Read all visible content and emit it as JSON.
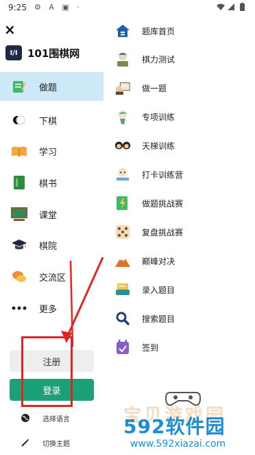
{
  "status_bar": {
    "time": "9:25",
    "icons": "⚙ A ▣ ·"
  },
  "drawer": {
    "close_label": "×",
    "brand_logo_text": "I/I",
    "brand_name": "101围棋网",
    "nav_items": [
      {
        "label": "做题",
        "icon": "pencil-notebook-icon",
        "active": true
      },
      {
        "label": "下棋",
        "icon": "go-stones-icon"
      },
      {
        "label": "学习",
        "icon": "open-book-icon"
      },
      {
        "label": "棋书",
        "icon": "green-book-icon"
      },
      {
        "label": "课堂",
        "icon": "classroom-board-icon"
      },
      {
        "label": "棋院",
        "icon": "graduation-cap-icon"
      },
      {
        "label": "交流区",
        "icon": "chat-bubbles-icon"
      },
      {
        "label": "更多",
        "icon": "more-dots-icon"
      }
    ],
    "register_label": "注册",
    "login_label": "登录",
    "bottom_links": [
      {
        "label": "选择语言",
        "icon": "globe-icon"
      },
      {
        "label": "切换主题",
        "icon": "magic-wand-icon"
      }
    ]
  },
  "menu": {
    "items": [
      {
        "label": "题库首页",
        "icon": "home-icon"
      },
      {
        "label": "棋力测试",
        "icon": "test-character-icon"
      },
      {
        "label": "做一题",
        "icon": "single-problem-icon"
      },
      {
        "label": "专项训练",
        "icon": "special-training-icon"
      },
      {
        "label": "天梯训练",
        "icon": "ladder-training-icon"
      },
      {
        "label": "打卡训练营",
        "icon": "checkin-camp-icon"
      },
      {
        "label": "做题挑战赛",
        "icon": "challenge-icon"
      },
      {
        "label": "复盘挑战赛",
        "icon": "dice-icon"
      },
      {
        "label": "巅峰对决",
        "icon": "mountain-icon"
      },
      {
        "label": "录入题目",
        "icon": "input-problem-icon"
      },
      {
        "label": "搜索题目",
        "icon": "search-icon"
      },
      {
        "label": "签到",
        "icon": "calendar-check-icon"
      }
    ]
  },
  "watermark": {
    "brand_digits": "592",
    "brand_text": "软件园",
    "url": "www.592xiazai.com",
    "background_text": "宝贝游戏园"
  },
  "colors": {
    "active_bg": "#cde8f7",
    "login_bg": "#1ba07a",
    "annotation_red": "#e02424",
    "watermark_blue": "#1a8ed8"
  }
}
